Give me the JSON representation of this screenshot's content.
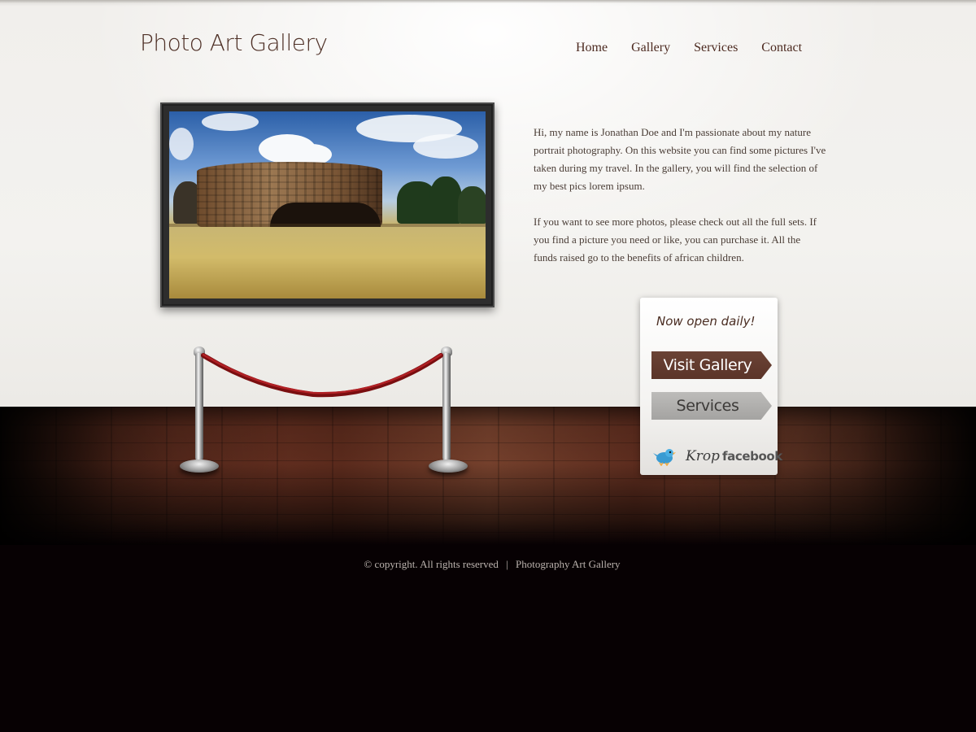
{
  "header": {
    "title": "Photo Art Gallery",
    "nav": [
      {
        "label": "Home"
      },
      {
        "label": "Gallery"
      },
      {
        "label": "Services"
      },
      {
        "label": "Contact"
      }
    ]
  },
  "intro": {
    "paragraph1": "Hi, my name is Jonathan Doe and I'm passionate about my nature portrait photography. On this website you can find some pictures I've taken during my travel. In the gallery, you will find the selection of my best pics lorem ipsum.",
    "paragraph2": "If you want to see more photos, please check out all the full sets. If you find a picture you need or like, you can purchase it. All the funds raised go to the benefits of african children."
  },
  "cta": {
    "tagline": "Now open daily!",
    "visit_label": "Visit Gallery",
    "services_label": "Services",
    "social": {
      "twitter_icon": "twitter-bird-icon",
      "krop_label": "Krop",
      "facebook_label": "facebook"
    }
  },
  "footer": {
    "copyright": "© copyright. All rights reserved",
    "separator": "|",
    "site_link": "Photography Art Gallery"
  },
  "colors": {
    "brand_brown": "#5b3428",
    "wall": "#f1efec",
    "footer_bg": "#070103"
  }
}
